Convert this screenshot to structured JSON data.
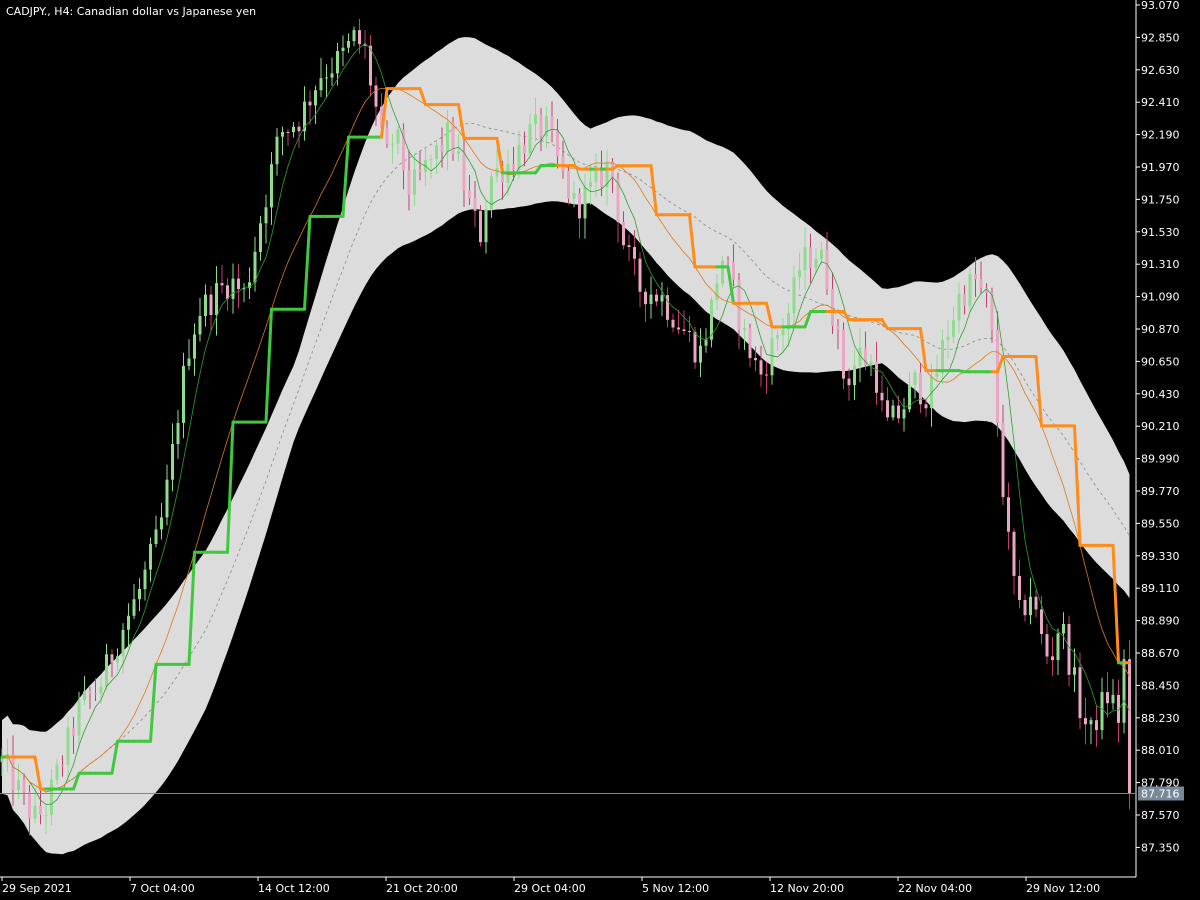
{
  "chart_data": {
    "type": "candlestick",
    "title": "CADJPY., H4:  Canadian dollar vs Japanese yen",
    "ylim": [
      87.17,
      93.07
    ],
    "y_ticks": [
      "93.070",
      "92.850",
      "92.630",
      "92.410",
      "92.190",
      "91.970",
      "91.750",
      "91.530",
      "91.310",
      "91.090",
      "90.870",
      "90.650",
      "90.430",
      "90.210",
      "89.990",
      "89.770",
      "89.550",
      "89.330",
      "89.110",
      "88.890",
      "88.670",
      "88.450",
      "88.230",
      "88.010",
      "87.790",
      "87.570",
      "87.350"
    ],
    "x_ticks": [
      "29 Sep 2021",
      "7 Oct 04:00",
      "14 Oct 12:00",
      "21 Oct 20:00",
      "29 Oct 04:00",
      "5 Nov 12:00",
      "12 Nov 20:00",
      "22 Nov 04:00",
      "29 Nov 12:00"
    ],
    "current_price": "87.716",
    "current_price_value": 87.716,
    "price_path": {
      "anchors": [
        [
          0,
          87.95
        ],
        [
          10,
          87.85
        ],
        [
          25,
          87.65
        ],
        [
          35,
          87.55
        ],
        [
          45,
          87.6
        ],
        [
          60,
          87.9
        ],
        [
          80,
          88.3
        ],
        [
          100,
          88.45
        ],
        [
          120,
          88.8
        ],
        [
          140,
          89.1
        ],
        [
          160,
          89.5
        ],
        [
          170,
          89.9
        ],
        [
          180,
          90.4
        ],
        [
          190,
          90.8
        ],
        [
          200,
          91.0
        ],
        [
          215,
          91.1
        ],
        [
          230,
          91.2
        ],
        [
          245,
          91.1
        ],
        [
          260,
          91.6
        ],
        [
          280,
          92.2
        ],
        [
          300,
          92.3
        ],
        [
          320,
          92.6
        ],
        [
          340,
          92.7
        ],
        [
          355,
          92.85
        ],
        [
          365,
          92.75
        ],
        [
          375,
          92.4
        ],
        [
          385,
          92.0
        ],
        [
          395,
          92.2
        ],
        [
          410,
          91.8
        ],
        [
          430,
          92.0
        ],
        [
          450,
          92.2
        ],
        [
          470,
          91.7
        ],
        [
          480,
          91.5
        ],
        [
          490,
          91.9
        ],
        [
          510,
          92.0
        ],
        [
          530,
          92.2
        ],
        [
          545,
          92.25
        ],
        [
          560,
          91.95
        ],
        [
          575,
          91.7
        ],
        [
          590,
          91.8
        ],
        [
          610,
          92.0
        ],
        [
          625,
          91.4
        ],
        [
          640,
          91.15
        ],
        [
          660,
          91.1
        ],
        [
          680,
          90.9
        ],
        [
          700,
          90.7
        ],
        [
          715,
          91.1
        ],
        [
          720,
          91.4
        ],
        [
          730,
          91.2
        ],
        [
          745,
          90.8
        ],
        [
          760,
          90.55
        ],
        [
          775,
          90.8
        ],
        [
          790,
          91.0
        ],
        [
          800,
          91.3
        ],
        [
          815,
          91.4
        ],
        [
          825,
          91.3
        ],
        [
          835,
          90.9
        ],
        [
          845,
          90.5
        ],
        [
          860,
          90.7
        ],
        [
          875,
          90.6
        ],
        [
          885,
          90.2
        ],
        [
          900,
          90.3
        ],
        [
          915,
          90.5
        ],
        [
          930,
          90.4
        ],
        [
          945,
          90.8
        ],
        [
          960,
          91.1
        ],
        [
          975,
          91.2
        ],
        [
          990,
          91.0
        ],
        [
          1000,
          90.0
        ],
        [
          1010,
          89.3
        ],
        [
          1020,
          88.9
        ],
        [
          1030,
          89.1
        ],
        [
          1040,
          88.8
        ],
        [
          1050,
          88.6
        ],
        [
          1060,
          88.9
        ],
        [
          1070,
          88.6
        ],
        [
          1080,
          88.3
        ],
        [
          1090,
          88.1
        ],
        [
          1100,
          88.3
        ],
        [
          1110,
          88.4
        ],
        [
          1120,
          88.2
        ],
        [
          1127,
          88.9
        ],
        [
          1130,
          87.75
        ]
      ]
    }
  }
}
